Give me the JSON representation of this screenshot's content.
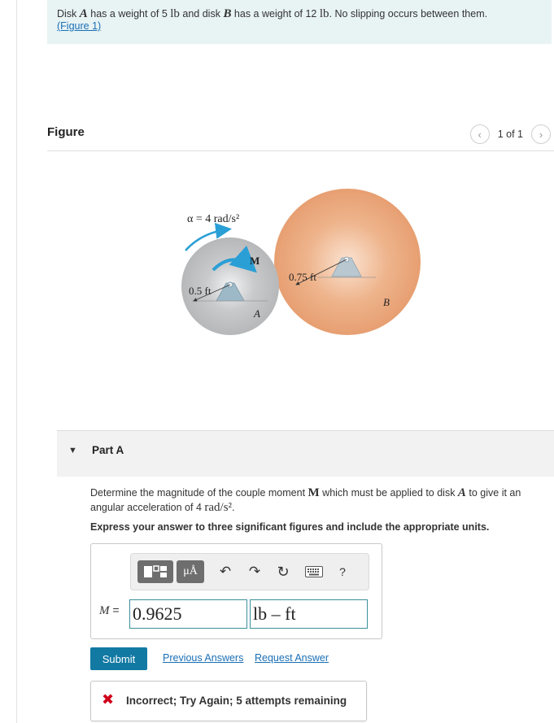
{
  "statement": {
    "pre_a": "Disk ",
    "disk_a": "A",
    "mid1": " has a weight of 5 ",
    "unit_lb1": "lb",
    "mid2": " and disk ",
    "disk_b": "B",
    "mid3": " has a weight of 12 ",
    "unit_lb2": "lb",
    "post": ". No slipping occurs between them.",
    "figure_link": "(Figure 1)"
  },
  "figure_panel": {
    "title": "Figure",
    "counter": "1 of 1",
    "prev_icon": "chevron-left-icon",
    "next_icon": "chevron-right-icon"
  },
  "figure": {
    "alpha_label": "α = 4 rad/s²",
    "moment_label": "M",
    "radius_a_label": "0.5 ft",
    "radius_b_label": "0.75 ft",
    "disk_a_label": "A",
    "disk_b_label": "B",
    "colors": {
      "disk_a": "#bfc0c2",
      "disk_b": "#e9a67a",
      "arrow": "#2a9fd6"
    }
  },
  "part": {
    "label": "Part A",
    "q_pre": "Determine the magnitude of the couple moment ",
    "q_m": "M",
    "q_mid": " which must be applied to disk ",
    "q_a": "A",
    "q_post": " to give it an angular acceleration of 4 ",
    "q_unit": "rad/s²",
    "q_end": ".",
    "instructions": "Express your answer to three significant figures and include the appropriate units."
  },
  "answer": {
    "toolbar": {
      "templates_icon": "templates-icon",
      "units_label": "μÅ",
      "undo_icon": "undo-icon",
      "redo_icon": "redo-icon",
      "reset_icon": "reset-icon",
      "keyboard_icon": "keyboard-icon",
      "help_label": "?"
    },
    "var_label": "M",
    "equals": "=",
    "value": "0.9625",
    "units": "lb – ft"
  },
  "actions": {
    "submit": "Submit",
    "previous_answers": "Previous Answers",
    "request_answer": "Request Answer"
  },
  "feedback": {
    "icon": "x-icon",
    "message": "Incorrect; Try Again; 5 attempts remaining",
    "color": "#d0021b"
  }
}
